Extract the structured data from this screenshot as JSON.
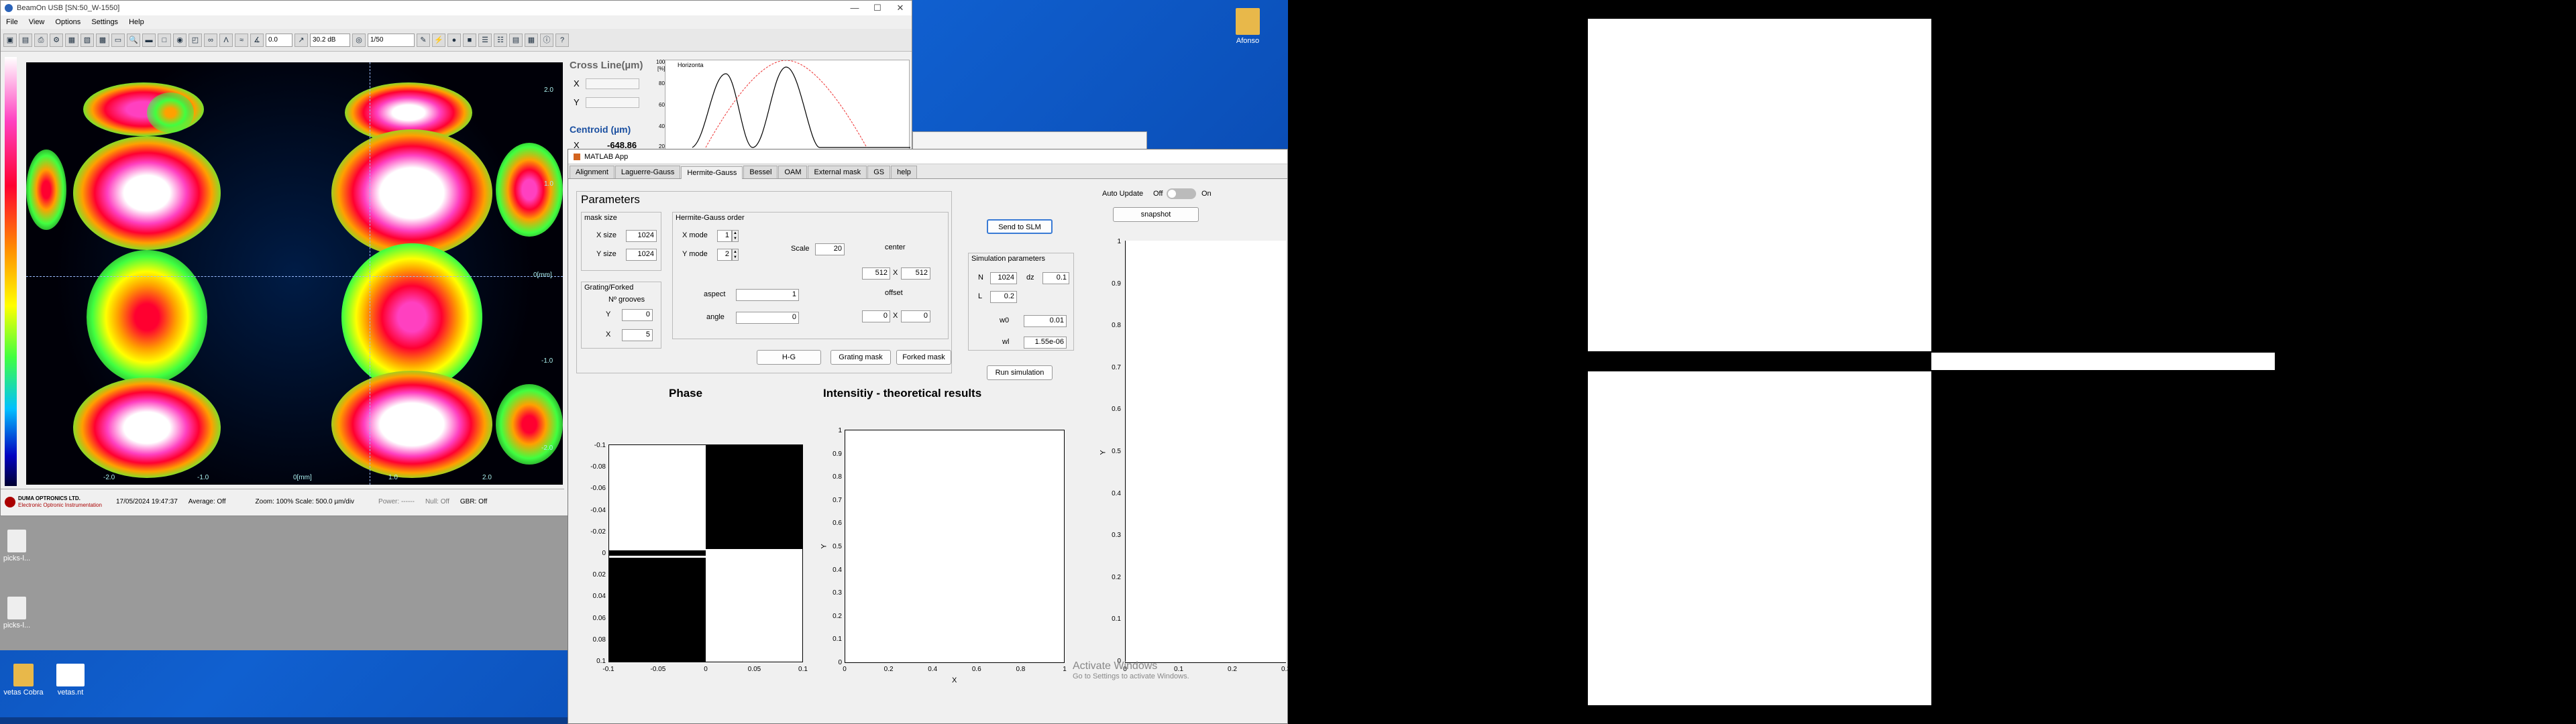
{
  "desktop": {
    "icon_top_right": "Afonso",
    "icons_left": [
      "picks-l...",
      "picks-l...",
      "vetas Cobra",
      "vetas.nt"
    ],
    "watermark_line1": "Activate Windows",
    "watermark_line2": "Go to Settings to activate Windows."
  },
  "beamon": {
    "title": "BeamOn USB  [SN:50_W-1550]",
    "menu": [
      "File",
      "View",
      "Options",
      "Settings",
      "Help"
    ],
    "toolbar": {
      "angle_value": "0.0",
      "db_value": "30.2 dB",
      "ratio_value": "1/50"
    },
    "xticks": [
      "-2.0",
      "-1.0",
      "0[mm]",
      "1.0",
      "2.0"
    ],
    "yticks": [
      "2.0",
      "1.0",
      "0[mm]",
      "-1.0",
      "-2.0"
    ],
    "status": {
      "logo_line1": "DUMA OPTRONICS LTD.",
      "logo_line2": "Electronic Optronic Instrumentation",
      "datetime": "17/05/2024 19:47:37",
      "average": "Average: Off",
      "zoom": "Zoom: 100%  Scale: 500.0 µm/div",
      "power": "Power: ------",
      "null": "Null: Off",
      "gbr": "GBR: Off"
    },
    "side": {
      "cross_title": "Cross Line(µm)",
      "x_label": "X",
      "y_label": "Y",
      "centroid_title": "Centroid (µm)",
      "centroid_x_label": "X",
      "centroid_x_value": "-648.86",
      "plot_title": "Horizonta",
      "plot_unit": "[%]",
      "plot_yticks": [
        "100",
        "80",
        "60",
        "40",
        "20"
      ]
    }
  },
  "matlab": {
    "title": "MATLAB App",
    "tabs": [
      "Alignment",
      "Laguerre-Gauss",
      "Hermite-Gauss",
      "Bessel",
      "OAM",
      "External mask",
      "GS",
      "help"
    ],
    "active_tab": "Hermite-Gauss",
    "parameters_title": "Parameters",
    "mask_size": {
      "title": "mask size",
      "x_label": "X size",
      "x_value": "1024",
      "y_label": "Y size",
      "y_value": "1024"
    },
    "grating": {
      "title": "Grating/Forked",
      "grooves_label": "Nº grooves",
      "y_label": "Y",
      "y_value": "0",
      "x_label": "X",
      "x_value": "5"
    },
    "hg_order": {
      "title": "Hermite-Gauss order",
      "xmode_label": "X mode",
      "xmode_value": "1",
      "ymode_label": "Y mode",
      "ymode_value": "2",
      "scale_label": "Scale",
      "scale_value": "20",
      "center_label": "center",
      "center_x": "512",
      "center_sep": "X",
      "center_y": "512",
      "aspect_label": "aspect",
      "aspect_value": "1",
      "offset_label": "offset",
      "offset_x": "0",
      "offset_sep": "X",
      "offset_y": "0",
      "angle_label": "angle",
      "angle_value": "0"
    },
    "buttons": {
      "hg": "H-G",
      "grating_mask": "Grating mask",
      "forked_mask": "Forked mask",
      "send_slm": "Send to SLM",
      "run_sim": "Run simulation",
      "snapshot": "snapshot"
    },
    "simulation": {
      "title": "Simulation parameters",
      "n_label": "N",
      "n_value": "1024",
      "dz_label": "dz",
      "dz_value": "0.1",
      "l_label": "L",
      "l_value": "0.2",
      "w0_label": "w0",
      "w0_value": "0.01",
      "wl_label": "wl",
      "wl_value": "1.55e-06"
    },
    "auto_update": {
      "label": "Auto Update",
      "off": "Off",
      "on": "On"
    },
    "phase_title": "Phase",
    "intensity_title": "Intensitiy - theoretical results",
    "phase_axes": {
      "yticks": [
        "-0.1",
        "-0.08",
        "-0.06",
        "-0.04",
        "-0.02",
        "0",
        "0.02",
        "0.04",
        "0.06",
        "0.08",
        "0.1"
      ],
      "xticks": [
        "-0.1",
        "-0.05",
        "0",
        "0.05",
        "0.1"
      ]
    },
    "intensity_axes": {
      "yticks": [
        "0",
        "0.1",
        "0.2",
        "0.3",
        "0.4",
        "0.5",
        "0.6",
        "0.7",
        "0.8",
        "0.9",
        "1"
      ],
      "xticks": [
        "0",
        "0.2",
        "0.4",
        "0.6",
        "0.8",
        "1"
      ],
      "xlabel": "X",
      "ylabel": "Y"
    },
    "right_axes": {
      "yticks": [
        "0",
        "0.1",
        "0.2",
        "0.3",
        "0.4",
        "0.5",
        "0.6",
        "0.7",
        "0.8",
        "0.9",
        "1"
      ],
      "xticks": [
        "0",
        "0.1",
        "0.2",
        "0.3"
      ],
      "ylabel": "Y"
    }
  }
}
